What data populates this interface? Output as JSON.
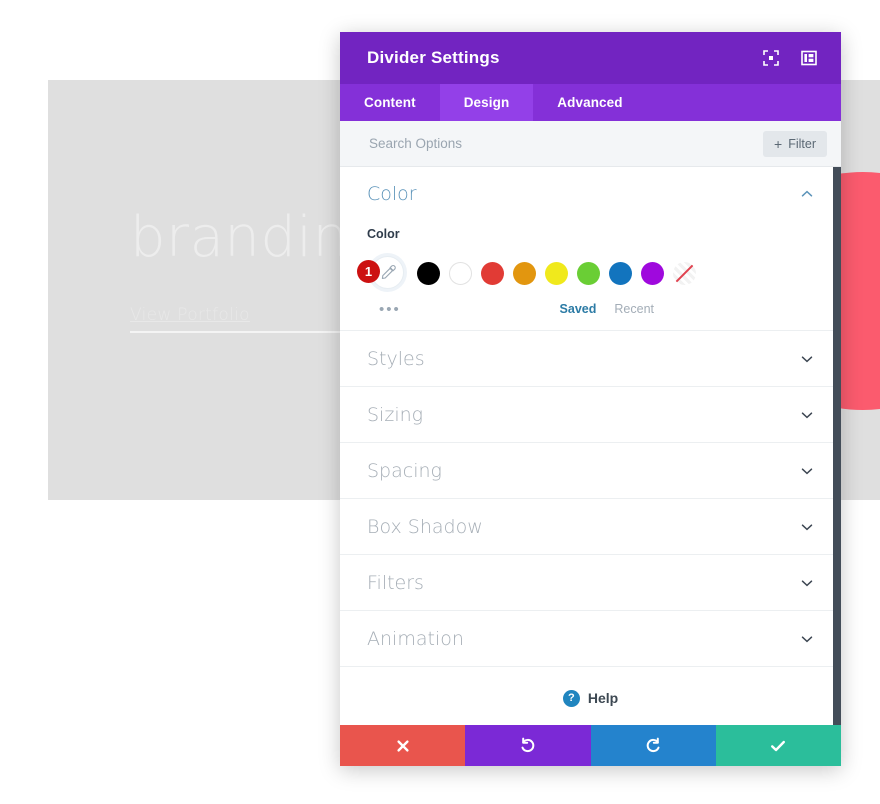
{
  "background": {
    "heading": "branding",
    "link_label": "View Portfolio",
    "block_color": "#dfdfdf",
    "blob_color": "#fb5b6e"
  },
  "modal": {
    "title": "Divider Settings",
    "header_color": "#7224c1",
    "header_icons": [
      {
        "name": "expand-icon"
      },
      {
        "name": "layout-panel-icon"
      }
    ],
    "tabs": [
      {
        "label": "Content",
        "active": false
      },
      {
        "label": "Design",
        "active": true
      },
      {
        "label": "Advanced",
        "active": false
      }
    ],
    "search": {
      "placeholder": "Search Options",
      "value": ""
    },
    "filter_button": {
      "label": "Filter",
      "plus": "+"
    },
    "color_section": {
      "title": "Color",
      "field_label": "Color",
      "expanded": true,
      "picker_badge": "1",
      "more_dots": "•••",
      "swatches": [
        {
          "name": "black",
          "hex": "#000000"
        },
        {
          "name": "white",
          "hex": "#ffffff"
        },
        {
          "name": "red",
          "hex": "#e13b35"
        },
        {
          "name": "orange",
          "hex": "#e2960f"
        },
        {
          "name": "yellow",
          "hex": "#f0e91c"
        },
        {
          "name": "green",
          "hex": "#6ace35"
        },
        {
          "name": "blue",
          "hex": "#1274be"
        },
        {
          "name": "purple",
          "hex": "#9f09dd"
        }
      ],
      "palette_tabs": [
        {
          "label": "Saved",
          "active": true
        },
        {
          "label": "Recent",
          "active": false
        }
      ]
    },
    "sections": [
      {
        "label": "Styles"
      },
      {
        "label": "Sizing"
      },
      {
        "label": "Spacing"
      },
      {
        "label": "Box Shadow"
      },
      {
        "label": "Filters"
      },
      {
        "label": "Animation"
      }
    ],
    "help": {
      "label": "Help",
      "glyph": "?"
    },
    "footer_buttons": [
      {
        "name": "cancel-button",
        "icon": "cross-icon",
        "color": "#e9554d"
      },
      {
        "name": "undo-button",
        "icon": "undo-icon",
        "color": "#7b29d6"
      },
      {
        "name": "redo-button",
        "icon": "redo-icon",
        "color": "#2483cd"
      },
      {
        "name": "save-button",
        "icon": "checkmark-icon",
        "color": "#2bbe9b"
      }
    ]
  }
}
